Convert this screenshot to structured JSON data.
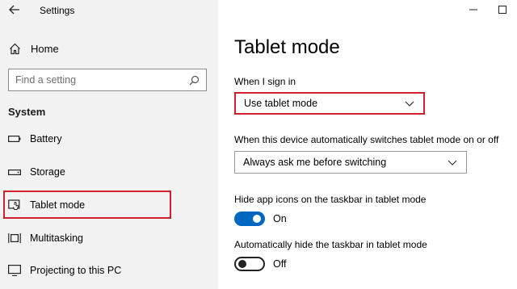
{
  "titlebar": {
    "title": "Settings"
  },
  "sidebar": {
    "home_label": "Home",
    "search_placeholder": "Find a setting",
    "section": "System",
    "items": [
      {
        "label": "Battery",
        "icon": "battery-icon"
      },
      {
        "label": "Storage",
        "icon": "storage-icon"
      },
      {
        "label": "Tablet mode",
        "icon": "tablet-mode-icon",
        "selected": true
      },
      {
        "label": "Multitasking",
        "icon": "multitasking-icon"
      },
      {
        "label": "Projecting to this PC",
        "icon": "projecting-icon"
      }
    ]
  },
  "main": {
    "title": "Tablet mode",
    "sign_in": {
      "label": "When I sign in",
      "value": "Use tablet mode"
    },
    "auto_switch": {
      "label": "When this device automatically switches tablet mode on or off",
      "value": "Always ask me before switching"
    },
    "hide_icons": {
      "label": "Hide app icons on the taskbar in tablet mode",
      "state": "On"
    },
    "hide_taskbar": {
      "label": "Automatically hide the taskbar in tablet mode",
      "state": "Off"
    }
  },
  "colors": {
    "accent": "#0067c0",
    "highlight": "#d0202a",
    "sidebar_bg": "#f2f2f2"
  }
}
